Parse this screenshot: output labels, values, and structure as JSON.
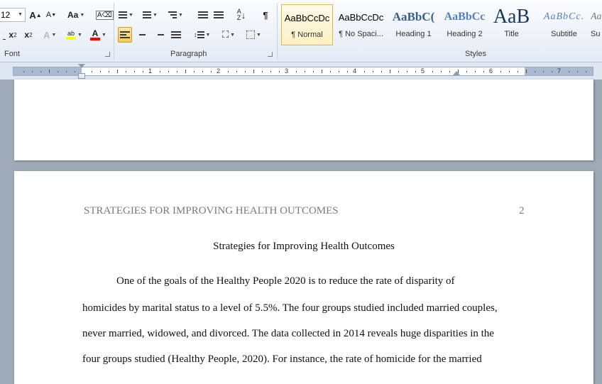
{
  "ribbon": {
    "font_size": "12",
    "groups": {
      "font": "Font",
      "paragraph": "Paragraph",
      "styles": "Styles"
    },
    "styles": [
      {
        "sample": "AaBbCcDc",
        "name": "¶ Normal",
        "selected": true
      },
      {
        "sample": "AaBbCcDc",
        "name": "¶ No Spaci..."
      },
      {
        "sample": "AaBbC(",
        "name": "Heading 1"
      },
      {
        "sample": "AaBbCc",
        "name": "Heading 2"
      },
      {
        "sample": "AaB",
        "name": "Title"
      },
      {
        "sample": "AaBbCc.",
        "name": "Subtitle"
      },
      {
        "sample": "Aa",
        "name": "Su"
      }
    ],
    "colors": {
      "highlight": "#ffff00",
      "font_color": "#ff0000",
      "accent": "#2b579a"
    }
  },
  "ruler": {
    "numbers": [
      "1",
      "2",
      "3",
      "4",
      "5",
      "6",
      "7"
    ]
  },
  "document": {
    "running_head": "STRATEGIES FOR IMPROVING HEALTH OUTCOMES",
    "page_number": "2",
    "title": "Strategies for Improving Health Outcomes",
    "lines": [
      "One of the goals of the Healthy People 2020 is to reduce the rate of disparity of",
      "homicides by marital status to a level of 5.5%. The four groups studied included married couples,",
      "never married, widowed, and divorced. The data collected in 2014 reveals huge disparities in the",
      "four groups studied (Healthy People, 2020). For instance, the rate of homicide for the married"
    ]
  }
}
